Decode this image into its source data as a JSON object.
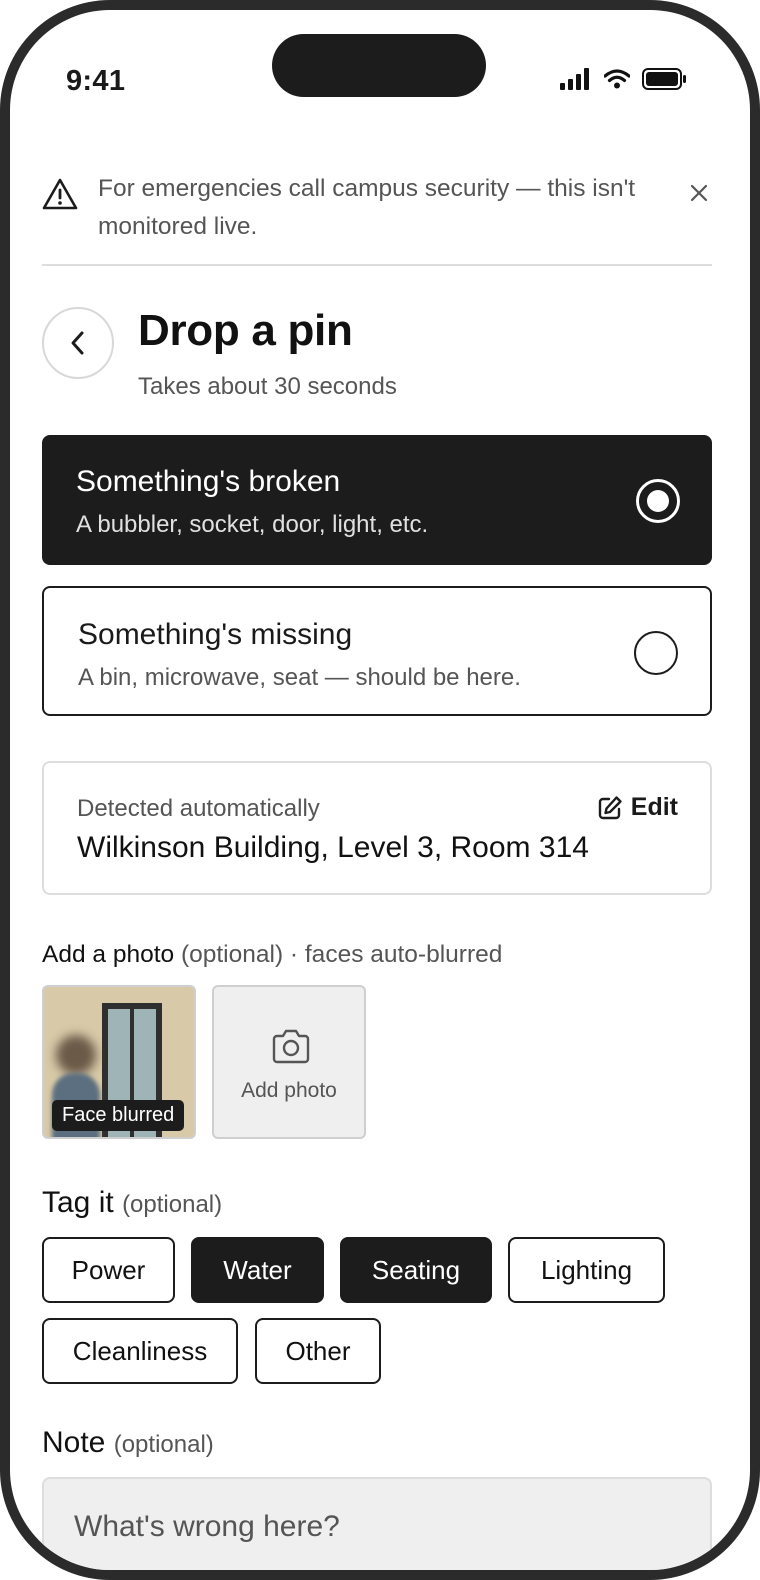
{
  "status_bar": {
    "time": "9:41"
  },
  "banner": {
    "text": "For emergencies call campus security — this isn't monitored live."
  },
  "header": {
    "title": "Drop a pin",
    "subtitle": "Takes about 30 seconds"
  },
  "report_types": [
    {
      "title": "Something's broken",
      "description": "A bubbler, socket, door, light, etc.",
      "selected": true
    },
    {
      "title": "Something's missing",
      "description": "A bin, microwave, seat — should be here.",
      "selected": false
    }
  ],
  "location": {
    "label": "Detected automatically",
    "value": "Wilkinson Building, Level 3, Room 314",
    "edit_label": "Edit"
  },
  "photo": {
    "heading": "Add a photo",
    "heading_note": "(optional) · faces auto-blurred",
    "thumbnail_badge": "Face blurred",
    "add_label": "Add photo"
  },
  "tags": {
    "heading": "Tag it",
    "heading_note": "(optional)",
    "items": [
      {
        "label": "Power",
        "selected": false
      },
      {
        "label": "Water",
        "selected": true
      },
      {
        "label": "Seating",
        "selected": true
      },
      {
        "label": "Lighting",
        "selected": false
      },
      {
        "label": "Cleanliness",
        "selected": false
      },
      {
        "label": "Other",
        "selected": false
      }
    ]
  },
  "note": {
    "heading": "Note",
    "heading_note": "(optional)",
    "placeholder": "What's wrong here?"
  },
  "colors": {
    "ink": "#1c1c1c",
    "muted": "#555555",
    "border": "#dddddd",
    "field_bg": "#efefef"
  }
}
